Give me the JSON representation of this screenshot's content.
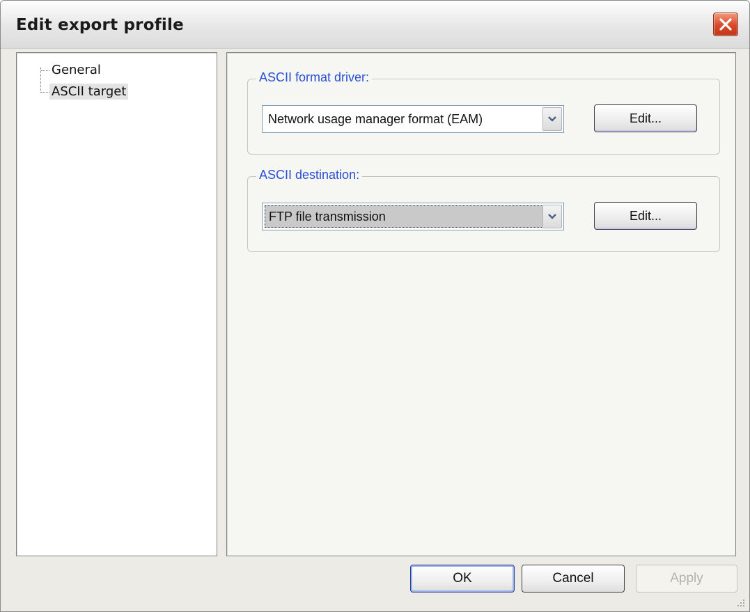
{
  "window": {
    "title": "Edit export profile"
  },
  "tree": {
    "items": [
      {
        "label": "General",
        "selected": false
      },
      {
        "label": "ASCII target",
        "selected": true
      }
    ]
  },
  "format_driver": {
    "group_label": "ASCII format driver:",
    "selected_value": "Network usage manager format (EAM)",
    "edit_label": "Edit..."
  },
  "destination": {
    "group_label": "ASCII destination:",
    "selected_value": "FTP file transmission",
    "edit_label": "Edit..."
  },
  "buttons": {
    "ok": "OK",
    "cancel": "Cancel",
    "apply": "Apply"
  },
  "colors": {
    "group_label": "#2a4fd6",
    "close_button": "#d8482a",
    "disabled_text": "#b3b3ad"
  },
  "icons": [
    "close-icon",
    "dropdown-arrow-icon",
    "resize-grip-icon"
  ]
}
